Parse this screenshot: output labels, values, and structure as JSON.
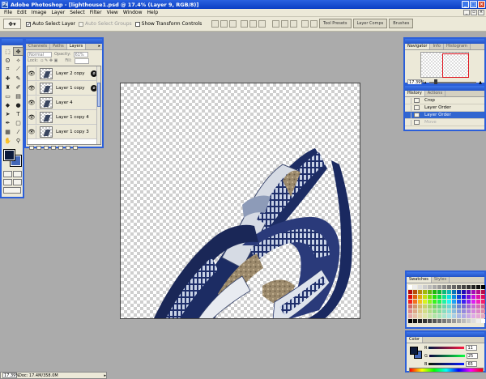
{
  "title_bar": {
    "text": "Adobe Photoshop - [lighthouse1.psd @ 17.4% (Layer 9, RGB/8)]"
  },
  "menu": [
    "File",
    "Edit",
    "Image",
    "Layer",
    "Select",
    "Filter",
    "View",
    "Window",
    "Help"
  ],
  "options_bar": {
    "auto_select_layer": "Auto Select Layer",
    "auto_select_groups": "Auto Select Groups",
    "show_transform_controls": "Show Transform Controls"
  },
  "palette_well": [
    "Tool Presets",
    "Layer Comps",
    "Brushes"
  ],
  "layers_panel": {
    "tabs": [
      "Channels",
      "Paths",
      "Layers"
    ],
    "blend_mode": "Normal",
    "opacity_label": "Opacity:",
    "opacity": "61%",
    "lock_label": "Lock:",
    "fill_label": "Fill:",
    "layers": [
      {
        "name": "Layer 2 copy",
        "fx": true
      },
      {
        "name": "Layer 1 copy",
        "fx": true
      },
      {
        "name": "Layer 4",
        "fx": false
      },
      {
        "name": "Layer 1 copy 4",
        "fx": false
      },
      {
        "name": "Layer 1 copy 3",
        "fx": false
      }
    ]
  },
  "navigator_panel": {
    "tabs": [
      "Navigator",
      "Info",
      "Histogram"
    ],
    "zoom": "17.39%"
  },
  "history_panel": {
    "tabs": [
      "History",
      "Actions"
    ],
    "items": [
      {
        "label": "Crop",
        "state": "normal"
      },
      {
        "label": "Layer Order",
        "state": "normal"
      },
      {
        "label": "Layer Order",
        "state": "selected"
      },
      {
        "label": "Move",
        "state": "dim"
      }
    ]
  },
  "swatches_panel": {
    "tabs": [
      "Swatches",
      "Styles"
    ]
  },
  "color_panel": {
    "tab": "Color",
    "r_label": "R",
    "r_value": "11",
    "g_label": "G",
    "g_value": "25",
    "b_label": "B",
    "b_value": "65"
  },
  "status_bar": {
    "zoom": "17.39%",
    "doc": "Doc: 17.4M/358.0M"
  },
  "colors": {
    "foreground": "#0c1a3b",
    "background": "#4468b8",
    "accent": "#2b5fd9"
  }
}
